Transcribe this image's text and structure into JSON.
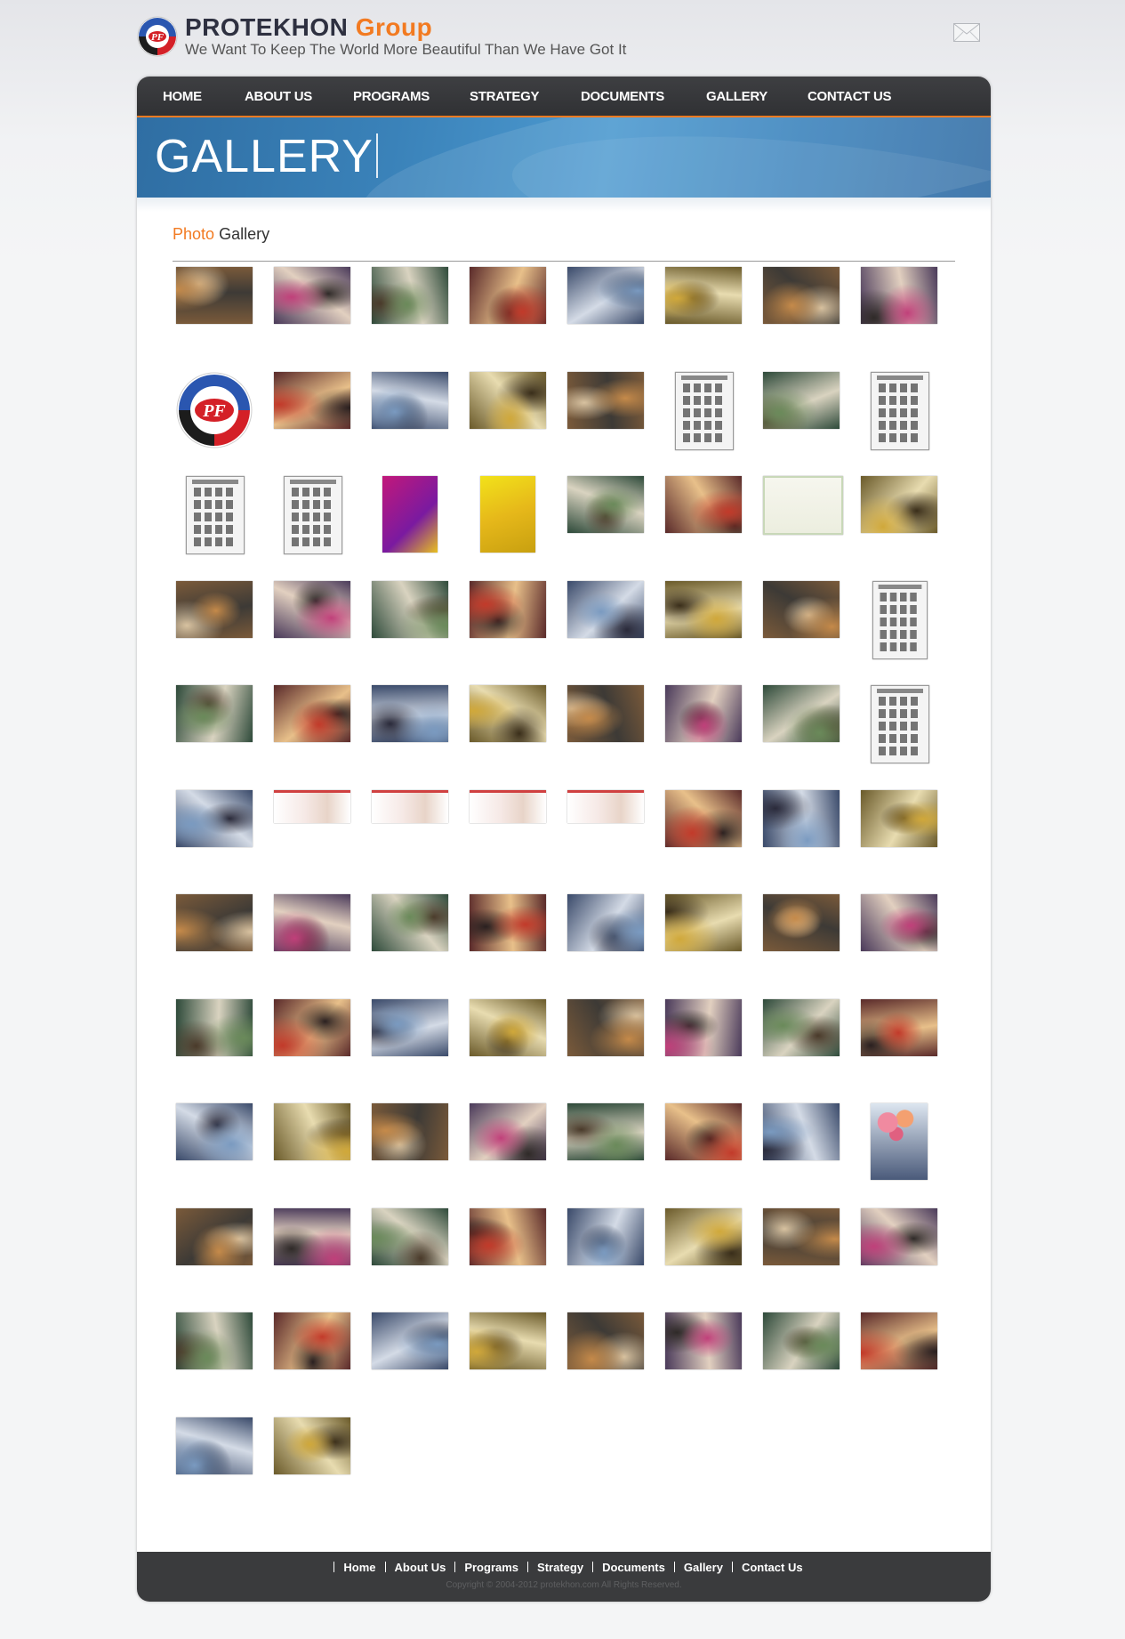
{
  "header": {
    "brand_main": "PROTEKHON",
    "brand_accent": "Group",
    "tagline": "We Want To Keep The World More Beautiful Than We Have Got It",
    "logo_icon": "protekhon-logo-icon",
    "mail_icon": "envelope-icon"
  },
  "nav": {
    "items": [
      {
        "label": "HOME"
      },
      {
        "label": "ABOUT US"
      },
      {
        "label": "PROGRAMS"
      },
      {
        "label": "STRATEGY"
      },
      {
        "label": "DOCUMENTS"
      },
      {
        "label": "GALLERY"
      },
      {
        "label": "CONTACT US"
      }
    ]
  },
  "banner": {
    "title": "GALLERY"
  },
  "gallery": {
    "title_accent": "Photo",
    "title_rest": "Gallery",
    "rows": 12,
    "per_row": 8,
    "total": 90
  },
  "footer": {
    "links": [
      "Home",
      "About Us",
      "Programs",
      "Strategy",
      "Documents",
      "Gallery",
      "Contact Us"
    ],
    "copyright": "Copyright © 2004-2012 protekhon.com All Rights Reserved."
  },
  "colors": {
    "accent": "#f27a21",
    "nav_bg": "#38393c",
    "banner_blue": "#3a82b9",
    "footer_bg": "#3a3b3d"
  }
}
